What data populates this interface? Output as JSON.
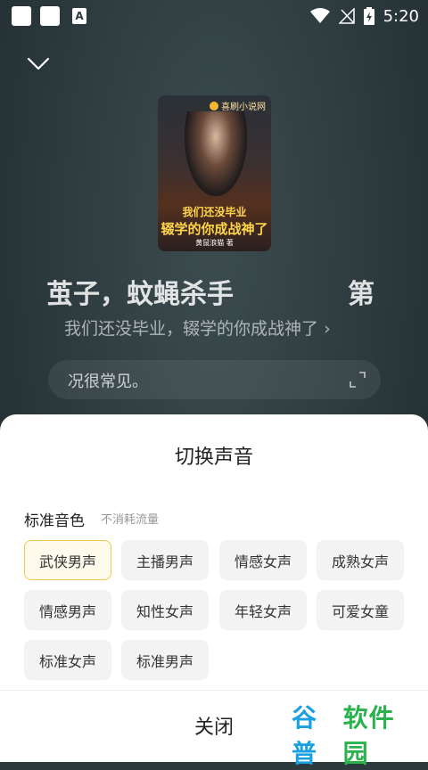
{
  "status_bar": {
    "time": "5:20"
  },
  "player": {
    "cover": {
      "badge": "喜刷小说网",
      "title_line1": "我们还没毕业",
      "title_line2": "辍学的你成战神了",
      "author": "黄鼠浪猫 著"
    },
    "chapter_title_left": "茧子，蚊蝇杀手",
    "chapter_title_right": "第",
    "book_title": "我们还没毕业，辍学的你成战神了",
    "subtitle_text": "况很常见。"
  },
  "voice_sheet": {
    "title": "切换声音",
    "section_label": "标准音色",
    "section_sub": "不消耗流量",
    "voices": [
      "武侠男声",
      "主播男声",
      "情感女声",
      "成熟女声",
      "情感男声",
      "知性女声",
      "年轻女声",
      "可爱女童",
      "标准女声",
      "标准男声"
    ],
    "selected_voice": "武侠男声",
    "close_label": "关闭"
  },
  "watermark": {
    "part1": "谷普",
    "part2": "软件园"
  },
  "colors": {
    "accent_selected_border": "#f2c94c",
    "accent_selected_bg": "#fffbec",
    "player_bg": "#2d3a3d"
  }
}
